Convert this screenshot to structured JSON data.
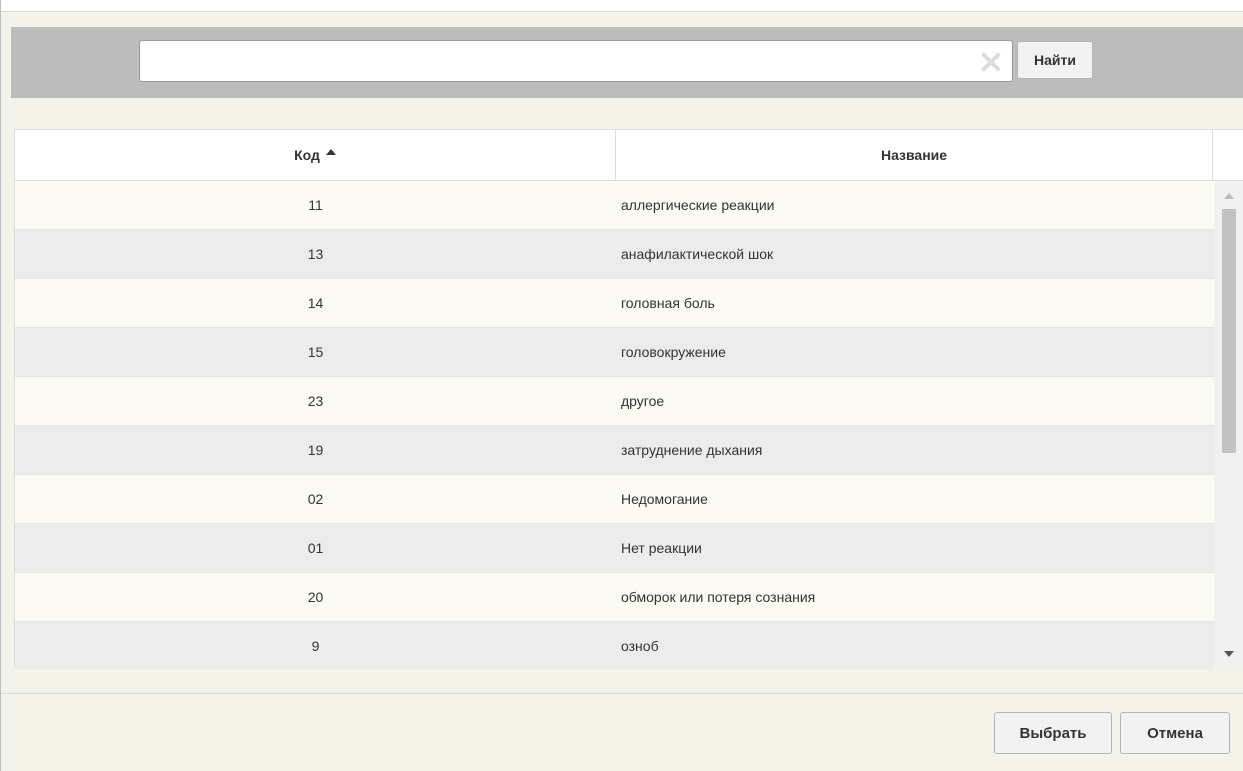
{
  "search": {
    "value": "",
    "placeholder": "",
    "find_label": "Найти"
  },
  "table": {
    "columns": [
      {
        "label": "Код",
        "sort": "ascending"
      },
      {
        "label": "Название"
      }
    ],
    "rows": [
      {
        "code": "11",
        "name": "аллергические реакции"
      },
      {
        "code": "13",
        "name": "анафилактической шок"
      },
      {
        "code": "14",
        "name": "головная боль"
      },
      {
        "code": "15",
        "name": "головокружение"
      },
      {
        "code": "23",
        "name": "другое"
      },
      {
        "code": "19",
        "name": "затруднение дыхания"
      },
      {
        "code": "02",
        "name": "Недомогание"
      },
      {
        "code": "01",
        "name": "Нет реакции"
      },
      {
        "code": "20",
        "name": "обморок или потеря сознания"
      },
      {
        "code": "9",
        "name": "озноб"
      }
    ]
  },
  "footer": {
    "select_label": "Выбрать",
    "cancel_label": "Отмена"
  },
  "icons": {
    "clear": "clear-x-icon",
    "sort": "sort-ascending-icon",
    "scroll_up": "scroll-up-arrow-icon",
    "scroll_down": "scroll-down-arrow-icon"
  },
  "colors": {
    "search_bar_bg": "#bcbcbc",
    "dialog_bg": "#f4f3ea",
    "row_odd": "#fbfaf3",
    "row_even": "#ececec"
  }
}
